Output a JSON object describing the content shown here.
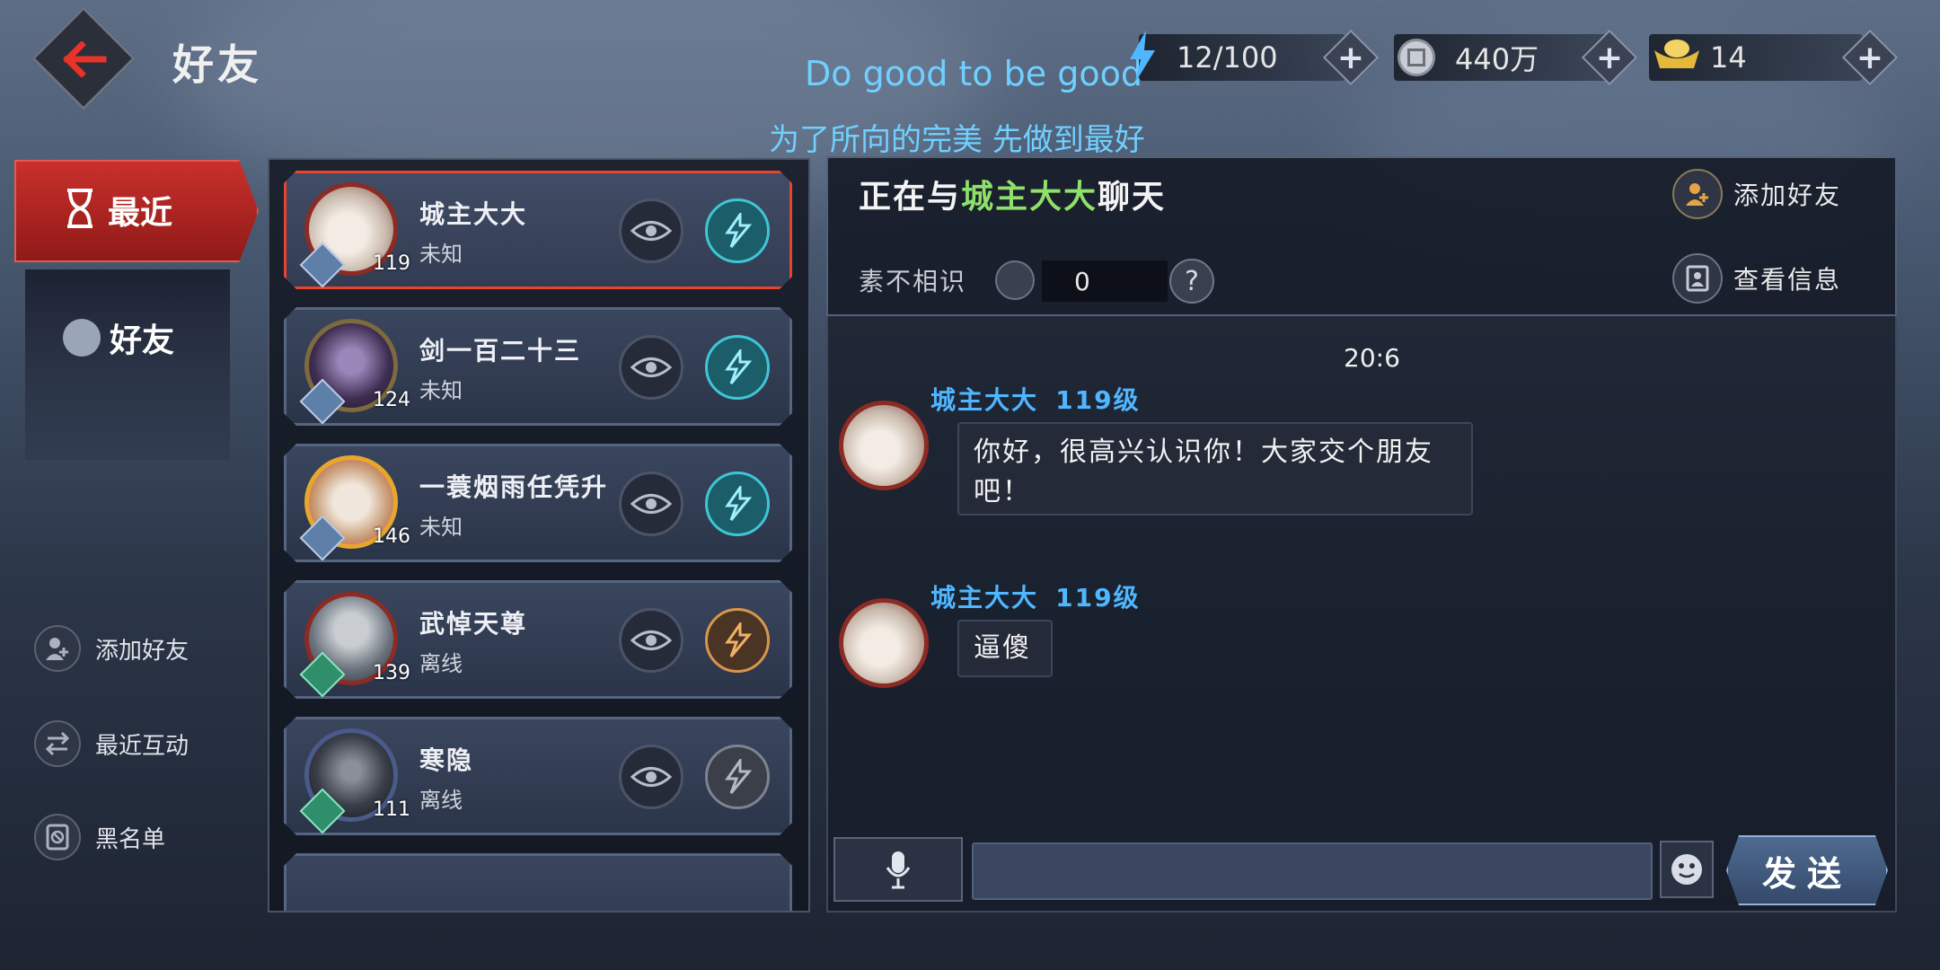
{
  "header": {
    "title": "好友"
  },
  "overlay": {
    "line1": "Do good to be good",
    "line2": "为了所向的完美 先做到最好"
  },
  "resources": [
    {
      "icon": "energy-icon",
      "value": "12/100"
    },
    {
      "icon": "coin-icon",
      "value": "440万"
    },
    {
      "icon": "gold-ingot-icon",
      "value": "14"
    }
  ],
  "tabs": {
    "recent": "最近",
    "friends": "好友"
  },
  "side_actions": {
    "add_friend": "添加好友",
    "recent_interaction": "最近互动",
    "blacklist": "黑名单"
  },
  "friends": [
    {
      "name": "城主大大",
      "status": "未知",
      "level": "119",
      "badge": "blue",
      "action": "cyan"
    },
    {
      "name": "剑一百二十三",
      "status": "未知",
      "level": "124",
      "badge": "blue",
      "action": "cyan"
    },
    {
      "name": "一蓑烟雨任凭升",
      "status": "未知",
      "level": "146",
      "badge": "blue",
      "action": "cyan"
    },
    {
      "name": "武悼天尊",
      "status": "离线",
      "level": "139",
      "badge": "green",
      "action": "orange"
    },
    {
      "name": "寒隐",
      "status": "离线",
      "level": "111",
      "badge": "green",
      "action": "gray"
    }
  ],
  "chat": {
    "title_prefix": "正在与",
    "partner": "城主大大",
    "title_suffix": "聊天",
    "relation_label": "素不相识",
    "relation_value": "0",
    "help": "?",
    "add_friend": "添加好友",
    "view_info": "查看信息",
    "timestamp": "20:6",
    "messages": [
      {
        "sender": "城主大大",
        "level": "119级",
        "text": "你好，很高兴认识你！大家交个朋友吧！"
      },
      {
        "sender": "城主大大",
        "level": "119级",
        "text": "逼傻"
      }
    ],
    "input_placeholder": "",
    "send": "发送"
  },
  "colors": {
    "accent_red": "#c9302c",
    "highlight_green": "#8ee06a",
    "name_blue": "#4fb6ff",
    "cyan": "#3fc6d5"
  }
}
